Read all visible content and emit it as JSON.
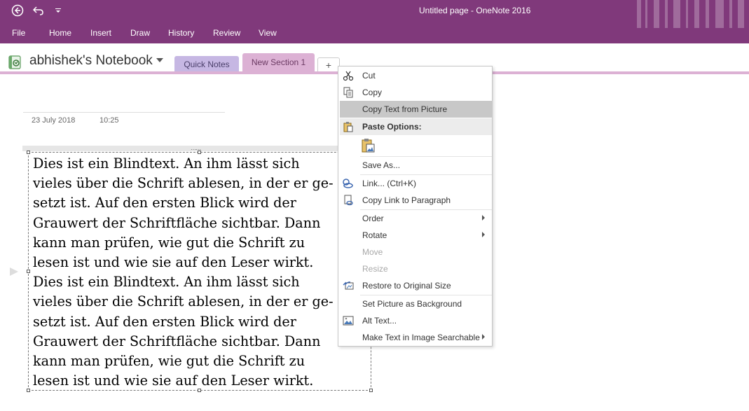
{
  "window": {
    "title": "Untitled page  -  OneNote 2016"
  },
  "quick_access": {
    "back_icon": "back-circle-icon",
    "undo_icon": "undo-icon",
    "customize_icon": "customize-qat-icon"
  },
  "ribbon_tabs": [
    "File",
    "Home",
    "Insert",
    "Draw",
    "History",
    "Review",
    "View"
  ],
  "notebook": {
    "name": "abhishek's Notebook"
  },
  "sections": [
    {
      "label": "Quick Notes",
      "color": "#c6b7e3"
    },
    {
      "label": "New Section 1",
      "color": "#dcb1d4",
      "active": true
    }
  ],
  "add_section_label": "+",
  "page": {
    "date": "23 July 2018",
    "time": "10:25",
    "image_text_lines": [
      "Dies ist ein Blindtext. An ihm lässt sich",
      "vieles über die Schrift ablesen, in der er ge-",
      "setzt ist. Auf den ersten Blick wird der",
      "Grauwert der Schriftfläche sichtbar. Dann",
      "kann man prüfen, wie gut die Schrift zu",
      "lesen ist und wie sie auf den Leser wirkt.",
      "Dies ist ein Blindtext. An ihm lässt sich",
      "vieles über die Schrift ablesen, in der er ge-",
      "setzt ist. Auf den ersten Blick wird der",
      "Grauwert der Schriftfläche sichtbar. Dann",
      "kann man prüfen, wie gut die Schrift zu",
      "lesen ist und wie sie auf den Leser wirkt."
    ]
  },
  "context_menu": {
    "cut": "Cut",
    "copy": "Copy",
    "copy_text_from_picture": "Copy Text from Picture",
    "paste_options": "Paste Options:",
    "save_as": "Save As...",
    "link": "Link...  (Ctrl+K)",
    "copy_link": "Copy Link to Paragraph",
    "order": "Order",
    "rotate": "Rotate",
    "move": "Move",
    "resize": "Resize",
    "restore": "Restore to Original Size",
    "set_background": "Set Picture as Background",
    "alt_text": "Alt Text...",
    "make_searchable": "Make Text in Image Searchable"
  },
  "colors": {
    "titlebar": "#80397b",
    "accent": "#dcb1d4"
  }
}
